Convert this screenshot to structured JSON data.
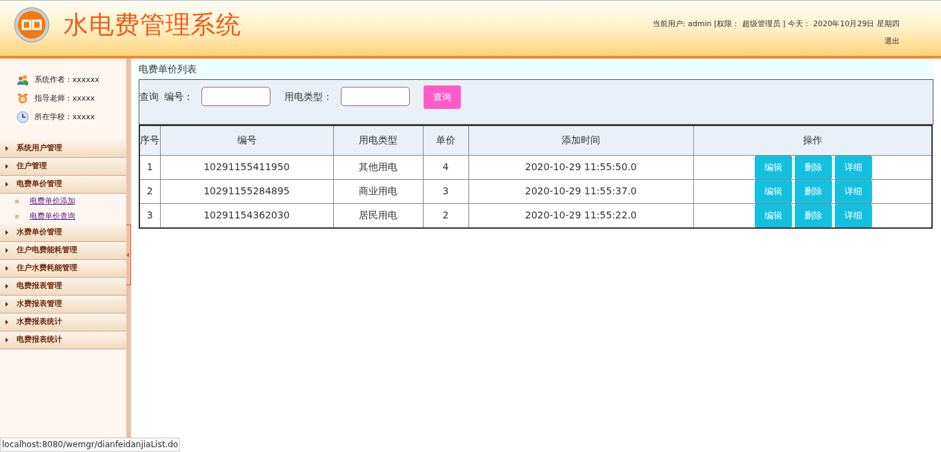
{
  "header": {
    "title": "水电费管理系统",
    "user_info": "当前用户: admin [权限： 超级管理员 ] 今天： 2020年10月29日 星期四",
    "logout": "退出"
  },
  "sidebar": {
    "info": [
      {
        "kind": "author",
        "text": "系统作者：xxxxxx"
      },
      {
        "kind": "teacher",
        "text": "指导老师：xxxxx"
      },
      {
        "kind": "school",
        "text": "所在学校：xxxxx"
      }
    ],
    "menu": [
      {
        "label": "系统用户管理"
      },
      {
        "label": "住户管理"
      },
      {
        "label": "电费单价管理",
        "children": [
          {
            "label": "电费单价添加"
          },
          {
            "label": "电费单价查询"
          }
        ]
      },
      {
        "label": "水费单价管理"
      },
      {
        "label": "住户电费能耗管理"
      },
      {
        "label": "住户水费耗能管理"
      },
      {
        "label": "电费报表管理"
      },
      {
        "label": "水费报表管理"
      },
      {
        "label": "水费报表统计"
      },
      {
        "label": "电费报表统计"
      }
    ]
  },
  "page_title": "电费单价列表",
  "search": {
    "prefix": "查询",
    "fields": [
      {
        "label": "编号："
      },
      {
        "label": "用电类型："
      }
    ],
    "button": "查询"
  },
  "table": {
    "columns": [
      "序号",
      "编号",
      "用电类型",
      "单价",
      "添加时间",
      "操作"
    ],
    "rows": [
      {
        "cells": [
          "1",
          "10291155411950",
          "其他用电",
          "4",
          "2020-10-29 11:55:50.0"
        ],
        "actions": [
          "编辑",
          "删除",
          "详细"
        ]
      },
      {
        "cells": [
          "2",
          "10291155284895",
          "商业用电",
          "3",
          "2020-10-29 11:55:37.0"
        ],
        "actions": [
          "编辑",
          "删除",
          "详细"
        ]
      },
      {
        "cells": [
          "3",
          "10291154362030",
          "居民用电",
          "2",
          "2020-10-29 11:55:22.0"
        ],
        "actions": [
          "编辑",
          "删除",
          "详细"
        ]
      }
    ]
  },
  "status_bar": {
    "url": "localhost:8080/wemgr/dianfeidanjiaList.do"
  }
}
